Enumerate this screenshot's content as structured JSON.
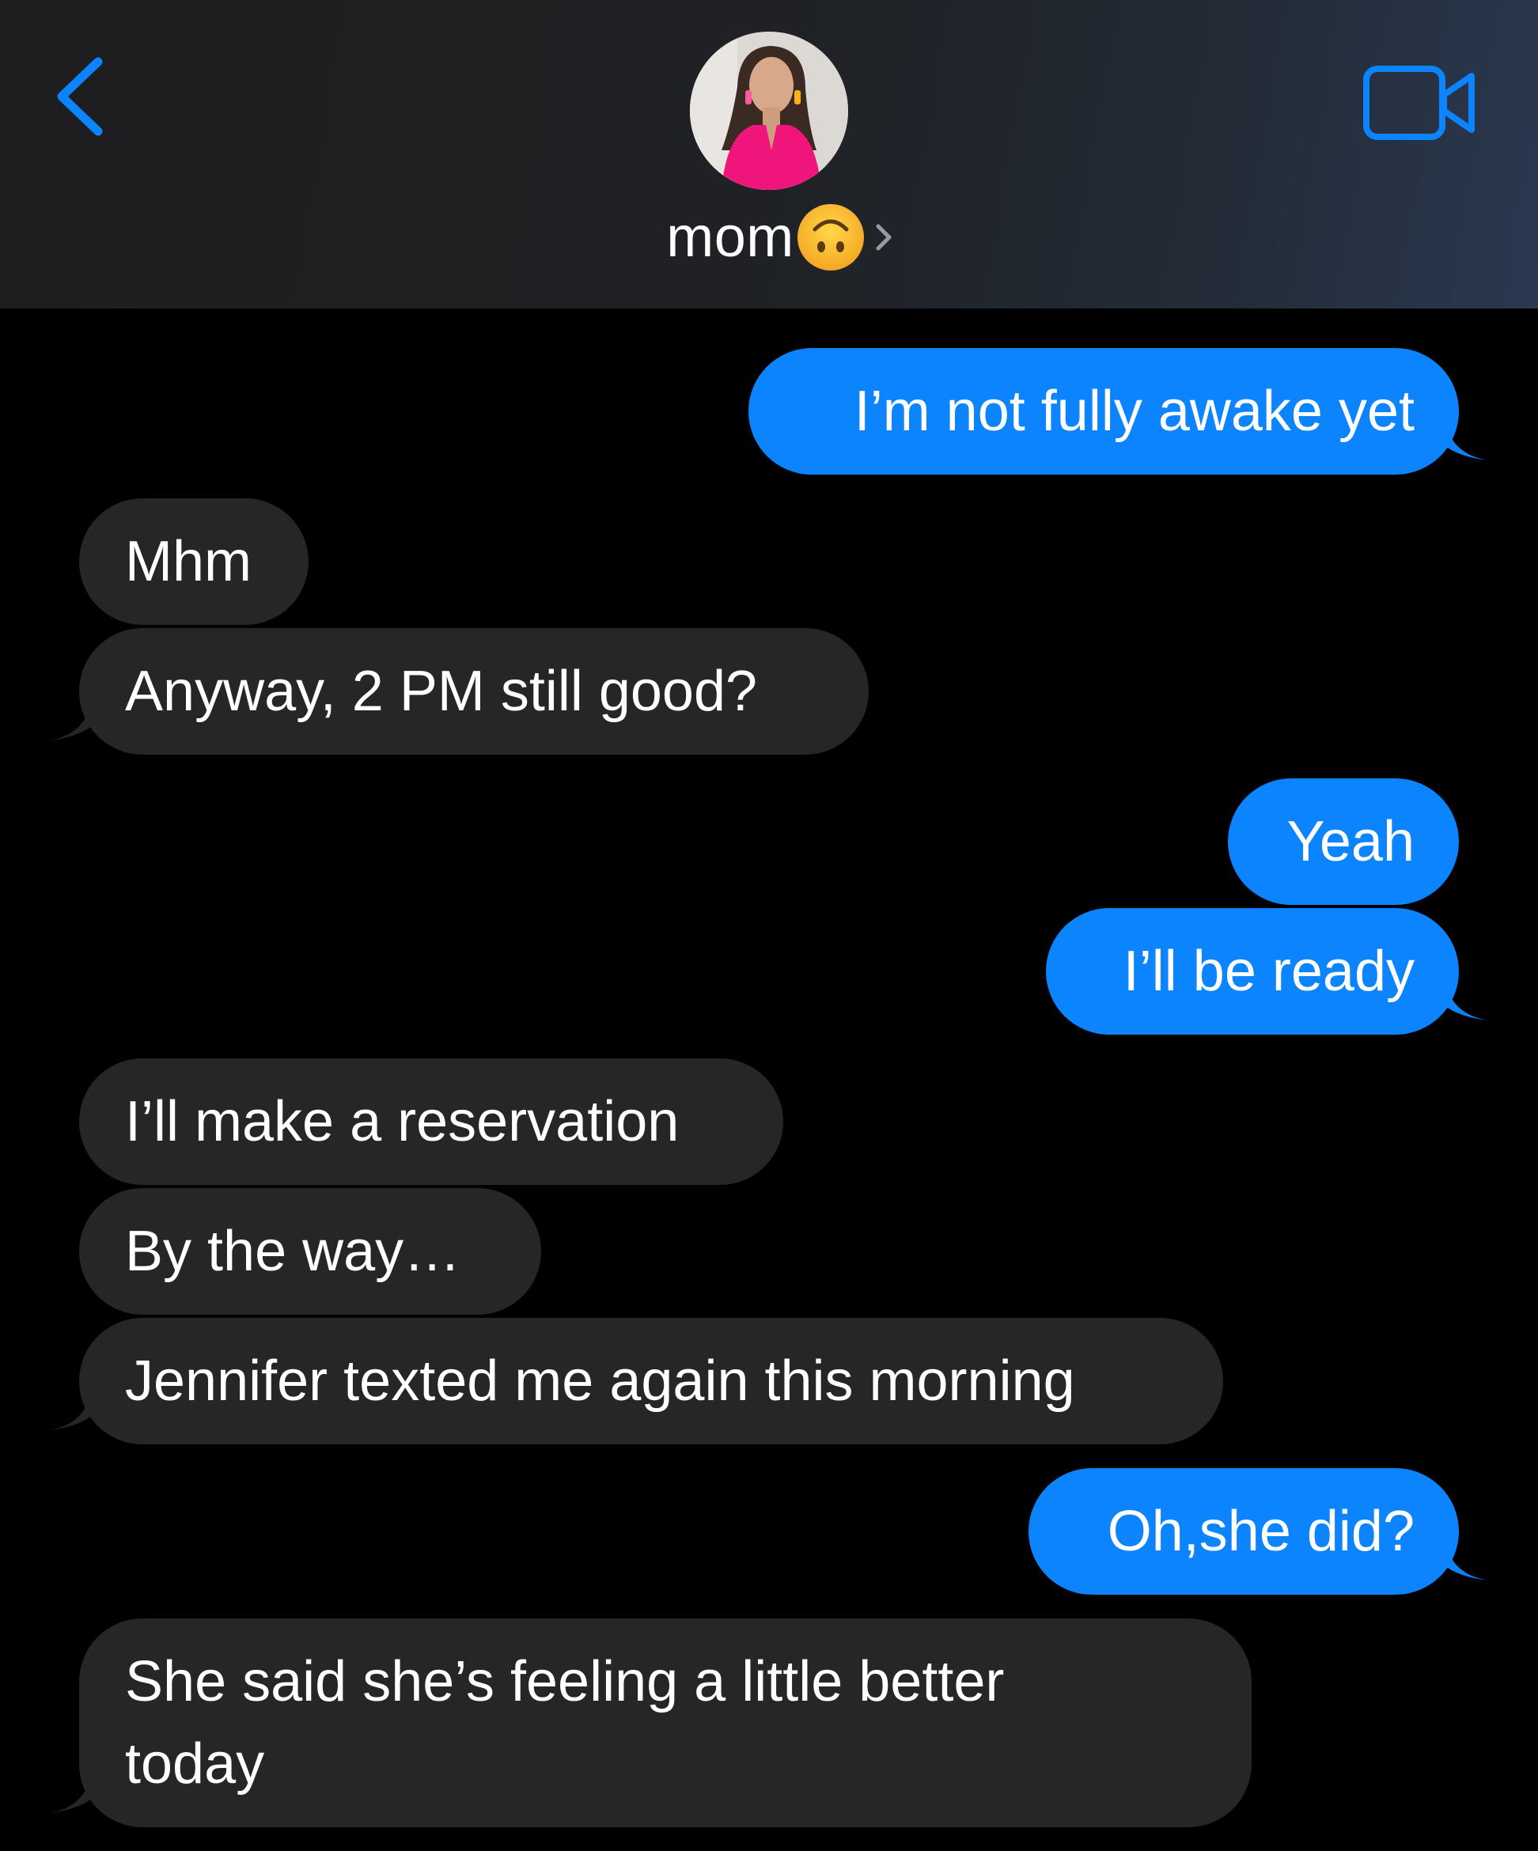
{
  "header": {
    "contact_name": "mom",
    "back_icon": "chevron-left-icon",
    "video_icon": "video-camera-icon",
    "status_emoji": "upside-down-face-emoji",
    "accent_color": "#0b84fe"
  },
  "messages": [
    {
      "side": "out",
      "text": "I’m not fully awake yet"
    },
    {
      "side": "in",
      "text": "Mhm"
    },
    {
      "side": "in",
      "text": "Anyway, 2 PM still good?"
    },
    {
      "side": "out",
      "text": "Yeah"
    },
    {
      "side": "out",
      "text": "I’ll be ready"
    },
    {
      "side": "in",
      "text": "I’ll make a reservation"
    },
    {
      "side": "in",
      "text": "By the way…"
    },
    {
      "side": "in",
      "text": "Jennifer texted me again this morning"
    },
    {
      "side": "out",
      "text": "Oh,she did?"
    },
    {
      "side": "in",
      "text": "She said she’s feeling a little better today"
    }
  ],
  "colors": {
    "outgoing_bubble": "#0b84fe",
    "incoming_bubble": "#262629",
    "background": "#000000"
  }
}
